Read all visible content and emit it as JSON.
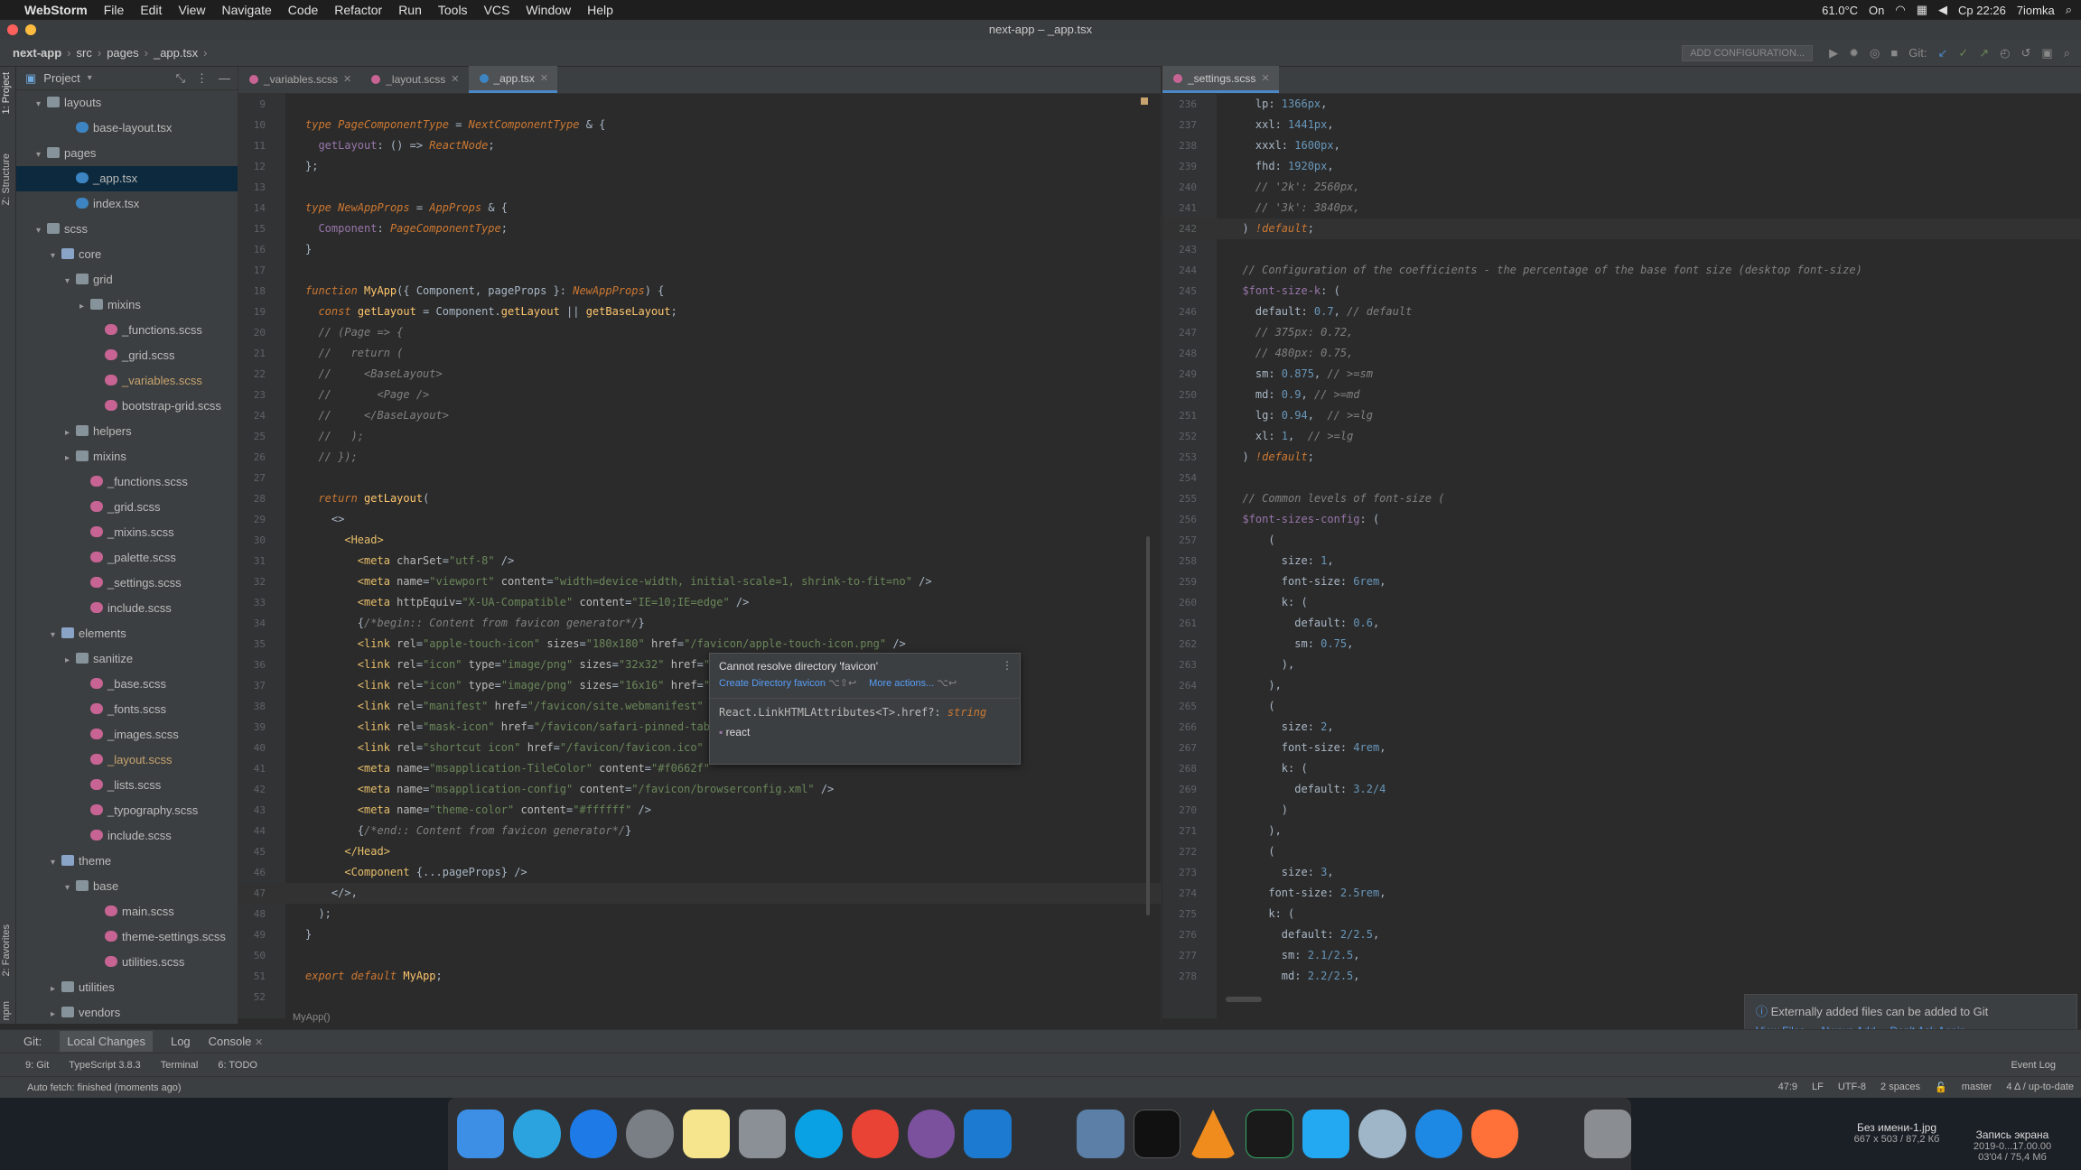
{
  "menubar": {
    "apple": "",
    "app": "WebStorm",
    "items": [
      "File",
      "Edit",
      "View",
      "Navigate",
      "Code",
      "Refactor",
      "Run",
      "Tools",
      "VCS",
      "Window",
      "Help"
    ],
    "temp": "61.0°C",
    "on": "On",
    "time": "Ср 22:26",
    "user": "7iomka"
  },
  "window": {
    "title": "next-app – _app.tsx"
  },
  "navbar": {
    "crumbs": [
      "next-app",
      "src",
      "pages",
      "_app.tsx"
    ],
    "runconfig": "ADD CONFIGURATION...",
    "git": "Git:"
  },
  "sidebar": {
    "vtabs": [
      "1: Project",
      "Z: Structure",
      "2: Favorites",
      "npm"
    ],
    "header": "Project"
  },
  "tree": [
    {
      "label": "layouts",
      "indent": 1,
      "arr": "▾",
      "icon": "folder"
    },
    {
      "label": "base-layout.tsx",
      "indent": 3,
      "arr": "",
      "icon": "tsx"
    },
    {
      "label": "pages",
      "indent": 1,
      "arr": "▾",
      "icon": "folder"
    },
    {
      "label": "_app.tsx",
      "indent": 3,
      "arr": "",
      "icon": "tsx",
      "sel": true
    },
    {
      "label": "index.tsx",
      "indent": 3,
      "arr": "",
      "icon": "tsx"
    },
    {
      "label": "scss",
      "indent": 1,
      "arr": "▾",
      "icon": "folder"
    },
    {
      "label": "core",
      "indent": 2,
      "arr": "▾",
      "icon": "fmod"
    },
    {
      "label": "grid",
      "indent": 3,
      "arr": "▾",
      "icon": "folder"
    },
    {
      "label": "mixins",
      "indent": 4,
      "arr": "▸",
      "icon": "folder"
    },
    {
      "label": "_functions.scss",
      "indent": 5,
      "arr": "",
      "icon": "scss"
    },
    {
      "label": "_grid.scss",
      "indent": 5,
      "arr": "",
      "icon": "scss"
    },
    {
      "label": "_variables.scss",
      "indent": 5,
      "arr": "",
      "icon": "scss",
      "mod": true
    },
    {
      "label": "bootstrap-grid.scss",
      "indent": 5,
      "arr": "",
      "icon": "scss"
    },
    {
      "label": "helpers",
      "indent": 3,
      "arr": "▸",
      "icon": "folder"
    },
    {
      "label": "mixins",
      "indent": 3,
      "arr": "▸",
      "icon": "folder"
    },
    {
      "label": "_functions.scss",
      "indent": 4,
      "arr": "",
      "icon": "scss"
    },
    {
      "label": "_grid.scss",
      "indent": 4,
      "arr": "",
      "icon": "scss"
    },
    {
      "label": "_mixins.scss",
      "indent": 4,
      "arr": "",
      "icon": "scss"
    },
    {
      "label": "_palette.scss",
      "indent": 4,
      "arr": "",
      "icon": "scss"
    },
    {
      "label": "_settings.scss",
      "indent": 4,
      "arr": "",
      "icon": "scss"
    },
    {
      "label": "include.scss",
      "indent": 4,
      "arr": "",
      "icon": "scss"
    },
    {
      "label": "elements",
      "indent": 2,
      "arr": "▾",
      "icon": "fmod"
    },
    {
      "label": "sanitize",
      "indent": 3,
      "arr": "▸",
      "icon": "folder"
    },
    {
      "label": "_base.scss",
      "indent": 4,
      "arr": "",
      "icon": "scss"
    },
    {
      "label": "_fonts.scss",
      "indent": 4,
      "arr": "",
      "icon": "scss"
    },
    {
      "label": "_images.scss",
      "indent": 4,
      "arr": "",
      "icon": "scss"
    },
    {
      "label": "_layout.scss",
      "indent": 4,
      "arr": "",
      "icon": "scss",
      "mod": true
    },
    {
      "label": "_lists.scss",
      "indent": 4,
      "arr": "",
      "icon": "scss"
    },
    {
      "label": "_typography.scss",
      "indent": 4,
      "arr": "",
      "icon": "scss"
    },
    {
      "label": "include.scss",
      "indent": 4,
      "arr": "",
      "icon": "scss"
    },
    {
      "label": "theme",
      "indent": 2,
      "arr": "▾",
      "icon": "fmod"
    },
    {
      "label": "base",
      "indent": 3,
      "arr": "▾",
      "icon": "folder"
    },
    {
      "label": "main.scss",
      "indent": 5,
      "arr": "",
      "icon": "scss"
    },
    {
      "label": "theme-settings.scss",
      "indent": 5,
      "arr": "",
      "icon": "scss"
    },
    {
      "label": "utilities.scss",
      "indent": 5,
      "arr": "",
      "icon": "scss"
    },
    {
      "label": "utilities",
      "indent": 2,
      "arr": "▸",
      "icon": "folder"
    },
    {
      "label": "vendors",
      "indent": 2,
      "arr": "▸",
      "icon": "folder"
    }
  ],
  "editor": {
    "tabs": [
      {
        "label": "_variables.scss",
        "icon": "scss"
      },
      {
        "label": "_layout.scss",
        "icon": "scss"
      },
      {
        "label": "_app.tsx",
        "icon": "tsx",
        "active": true
      }
    ],
    "breadcrumb": "MyApp()",
    "lines": [
      {
        "n": "9",
        "h": ""
      },
      {
        "n": "10",
        "h": "<span class='kw'>type</span> <span class='ty'>PageComponentType</span> = <span class='ty'>NextComponentType</span> & {"
      },
      {
        "n": "11",
        "h": "  <span class='var'>getLayout</span>: () => <span class='ty'>ReactNode</span>;"
      },
      {
        "n": "12",
        "h": "};"
      },
      {
        "n": "13",
        "h": ""
      },
      {
        "n": "14",
        "h": "<span class='kw'>type</span> <span class='ty'>NewAppProps</span> = <span class='ty'>AppProps</span> & {"
      },
      {
        "n": "15",
        "h": "  <span class='var'>Component</span>: <span class='ty'>PageComponentType</span>;"
      },
      {
        "n": "16",
        "h": "}"
      },
      {
        "n": "17",
        "h": ""
      },
      {
        "n": "18",
        "h": "<span class='kw'>function</span> <span class='fn'>MyApp</span>({ Component, pageProps }: <span class='ty'>NewAppProps</span>) {"
      },
      {
        "n": "19",
        "h": "  <span class='kw'>const</span> <span class='fn'>getLayout</span> = Component.<span class='fn'>getLayout</span> || <span class='fn'>getBaseLayout</span>;"
      },
      {
        "n": "20",
        "h": "  <span class='cm'>// (Page => {</span>"
      },
      {
        "n": "21",
        "h": "  <span class='cm'>//   return (</span>"
      },
      {
        "n": "22",
        "h": "  <span class='cm'>//     &lt;BaseLayout&gt;</span>"
      },
      {
        "n": "23",
        "h": "  <span class='cm'>//       &lt;Page /&gt;</span>"
      },
      {
        "n": "24",
        "h": "  <span class='cm'>//     &lt;/BaseLayout&gt;</span>"
      },
      {
        "n": "25",
        "h": "  <span class='cm'>//   );</span>"
      },
      {
        "n": "26",
        "h": "  <span class='cm'>// });</span>"
      },
      {
        "n": "27",
        "h": ""
      },
      {
        "n": "28",
        "h": "  <span class='kw'>return</span> <span class='fn'>getLayout</span>("
      },
      {
        "n": "29",
        "h": "    &lt;&gt;"
      },
      {
        "n": "30",
        "h": "      <span class='tag'>&lt;Head&gt;</span>"
      },
      {
        "n": "31",
        "h": "        <span class='tag'>&lt;meta</span> <span class='attr'>charSet</span>=<span class='str'>\"utf-8\"</span> /&gt;"
      },
      {
        "n": "32",
        "h": "        <span class='tag'>&lt;meta</span> <span class='attr'>name</span>=<span class='str'>\"viewport\"</span> <span class='attr'>content</span>=<span class='str'>\"width=device-width, initial-scale=1, shrink-to-fit=no\"</span> /&gt;"
      },
      {
        "n": "33",
        "h": "        <span class='tag'>&lt;meta</span> <span class='attr'>httpEquiv</span>=<span class='str'>\"X-UA-Compatible\"</span> <span class='attr'>content</span>=<span class='str'>\"IE=10;IE=edge\"</span> /&gt;"
      },
      {
        "n": "34",
        "h": "        {<span class='cm'>/*begin:: Content from favicon generator*/</span>}"
      },
      {
        "n": "35",
        "h": "        <span class='tag'>&lt;link</span> <span class='attr'>rel</span>=<span class='str'>\"apple-touch-icon\"</span> <span class='attr'>sizes</span>=<span class='str'>\"180x180\"</span> <span class='attr'>href</span>=<span class='str'>\"/favicon/apple-touch-icon.png\"</span> /&gt;"
      },
      {
        "n": "36",
        "h": "        <span class='tag'>&lt;link</span> <span class='attr'>rel</span>=<span class='str'>\"icon\"</span> <span class='attr'>type</span>=<span class='str'>\"image/png\"</span> <span class='attr'>sizes</span>=<span class='str'>\"32x32\"</span> <span class='attr'>href</span>=<span class='str'>\"/</span>"
      },
      {
        "n": "37",
        "h": "        <span class='tag'>&lt;link</span> <span class='attr'>rel</span>=<span class='str'>\"icon\"</span> <span class='attr'>type</span>=<span class='str'>\"image/png\"</span> <span class='attr'>sizes</span>=<span class='str'>\"16x16\"</span> <span class='attr'>href</span>=<span class='str'>\"/</span>"
      },
      {
        "n": "38",
        "h": "        <span class='tag'>&lt;link</span> <span class='attr'>rel</span>=<span class='str'>\"manifest\"</span> <span class='attr'>href</span>=<span class='str'>\"/favicon/site.webmanifest\"</span> /"
      },
      {
        "n": "39",
        "h": "        <span class='tag'>&lt;link</span> <span class='attr'>rel</span>=<span class='str'>\"mask-icon\"</span> <span class='attr'>href</span>=<span class='str'>\"/favicon/safari-pinned-tab.</span>"
      },
      {
        "n": "40",
        "h": "        <span class='tag'>&lt;link</span> <span class='attr'>rel</span>=<span class='str'>\"shortcut icon\"</span> <span class='attr'>href</span>=<span class='str'>\"/favicon/favicon.ico\"</span> /"
      },
      {
        "n": "41",
        "h": "        <span class='tag'>&lt;meta</span> <span class='attr'>name</span>=<span class='str'>\"msapplication-TileColor\"</span> <span class='attr'>content</span>=<span class='str'>\"#f0662f\"</span>"
      },
      {
        "n": "42",
        "h": "        <span class='tag'>&lt;meta</span> <span class='attr'>name</span>=<span class='str'>\"msapplication-config\"</span> <span class='attr'>content</span>=<span class='str'>\"/favicon/browserconfig.xml\"</span> /&gt;"
      },
      {
        "n": "43",
        "h": "        <span class='tag'>&lt;meta</span> <span class='attr'>name</span>=<span class='str'>\"theme-color\"</span> <span class='attr'>content</span>=<span class='str'>\"#ffffff\"</span> /&gt;"
      },
      {
        "n": "44",
        "h": "        {<span class='cm'>/*end:: Content from favicon generator*/</span>}"
      },
      {
        "n": "45",
        "h": "      <span class='tag'>&lt;/Head&gt;</span>"
      },
      {
        "n": "46",
        "h": "      <span class='tag'>&lt;Component</span> {...pageProps} /&gt;"
      },
      {
        "n": "47",
        "h": "    &lt;/&gt;,",
        "cur": true
      },
      {
        "n": "48",
        "h": "  );"
      },
      {
        "n": "49",
        "h": "}"
      },
      {
        "n": "50",
        "h": ""
      },
      {
        "n": "51",
        "h": "<span class='kw'>export default</span> <span class='fn'>MyApp</span>;"
      },
      {
        "n": "52",
        "h": ""
      }
    ]
  },
  "popup": {
    "title": "Cannot resolve directory 'favicon'",
    "action1": "Create Directory favicon",
    "key1": "⌥⇧↩",
    "action2": "More actions...",
    "key2": "⌥↩",
    "sig": "React.LinkHTMLAttributes<T>.href?:",
    "sigtype": "string",
    "pkg": "react"
  },
  "editor2": {
    "tab": "_settings.scss",
    "lines": [
      {
        "n": "236",
        "h": "    lp: <span class='num2'>1366px</span>,"
      },
      {
        "n": "237",
        "h": "    xxl: <span class='num2'>1441px</span>,"
      },
      {
        "n": "238",
        "h": "    xxxl: <span class='num2'>1600px</span>,"
      },
      {
        "n": "239",
        "h": "    fhd: <span class='num2'>1920px</span>,"
      },
      {
        "n": "240",
        "h": "    <span class='cm'>// '2k': 2560px,</span>"
      },
      {
        "n": "241",
        "h": "    <span class='cm'>// '3k': 3840px,</span>"
      },
      {
        "n": "242",
        "h": "  ) <span class='kw'>!default</span>;",
        "cur": true
      },
      {
        "n": "243",
        "h": ""
      },
      {
        "n": "244",
        "h": "  <span class='cm'>// Configuration of the coefficients - the percentage of the base font size (desktop font-size)</span>"
      },
      {
        "n": "245",
        "h": "  <span class='var'>$font-size-k</span>: ("
      },
      {
        "n": "246",
        "h": "    default: <span class='num2'>0.7</span>, <span class='cm'>// default</span>"
      },
      {
        "n": "247",
        "h": "    <span class='cm'>// 375px: 0.72,</span>"
      },
      {
        "n": "248",
        "h": "    <span class='cm'>// 480px: 0.75,</span>"
      },
      {
        "n": "249",
        "h": "    sm: <span class='num2'>0.875</span>, <span class='cm'>// >=sm</span>"
      },
      {
        "n": "250",
        "h": "    md: <span class='num2'>0.9</span>, <span class='cm'>// >=md</span>"
      },
      {
        "n": "251",
        "h": "    lg: <span class='num2'>0.94</span>,  <span class='cm'>// >=lg</span>"
      },
      {
        "n": "252",
        "h": "    xl: <span class='num2'>1</span>,  <span class='cm'>// >=lg</span>"
      },
      {
        "n": "253",
        "h": "  ) <span class='kw'>!default</span>;"
      },
      {
        "n": "254",
        "h": ""
      },
      {
        "n": "255",
        "h": "  <span class='cm'>// Common levels of font-size (</span>"
      },
      {
        "n": "256",
        "h": "  <span class='var'>$font-sizes-config</span>: ("
      },
      {
        "n": "257",
        "h": "      ("
      },
      {
        "n": "258",
        "h": "        size: <span class='num2'>1</span>,"
      },
      {
        "n": "259",
        "h": "        font-size: <span class='num2'>6rem</span>,"
      },
      {
        "n": "260",
        "h": "        k: ("
      },
      {
        "n": "261",
        "h": "          default: <span class='num2'>0.6</span>,"
      },
      {
        "n": "262",
        "h": "          sm: <span class='num2'>0.75</span>,"
      },
      {
        "n": "263",
        "h": "        ),"
      },
      {
        "n": "264",
        "h": "      ),"
      },
      {
        "n": "265",
        "h": "      ("
      },
      {
        "n": "266",
        "h": "        size: <span class='num2'>2</span>,"
      },
      {
        "n": "267",
        "h": "        font-size: <span class='num2'>4rem</span>,"
      },
      {
        "n": "268",
        "h": "        k: ("
      },
      {
        "n": "269",
        "h": "          default: <span class='num2'>3.2/4</span>"
      },
      {
        "n": "270",
        "h": "        )"
      },
      {
        "n": "271",
        "h": "      ),"
      },
      {
        "n": "272",
        "h": "      ("
      },
      {
        "n": "273",
        "h": "        size: <span class='num2'>3</span>,"
      },
      {
        "n": "274",
        "h": "      font-size: <span class='num2'>2.5rem</span>,"
      },
      {
        "n": "275",
        "h": "      k: ("
      },
      {
        "n": "276",
        "h": "        default: <span class='num2'>2/2.5</span>,"
      },
      {
        "n": "277",
        "h": "        sm: <span class='num2'>2.1/2.5</span>,"
      },
      {
        "n": "278",
        "h": "        md: <span class='num2'>2.2/2.5</span>,"
      }
    ]
  },
  "notif": {
    "title": "Externally added files can be added to Git",
    "l1": "View Files",
    "l2": "Always Add",
    "l3": "Don't Ask Again"
  },
  "bottom": {
    "git": "Git:",
    "tabs": [
      "Local Changes",
      "Log",
      "Console"
    ]
  },
  "toolwin": {
    "items": [
      "9: Git",
      "TypeScript 3.8.3",
      "Terminal",
      "6: TODO"
    ],
    "eventlog": "Event Log"
  },
  "status": {
    "msg": "Auto fetch: finished (moments ago)",
    "pos": "47:9",
    "lf": "LF",
    "enc": "UTF-8",
    "indent": "2 spaces",
    "branch": "master",
    "vcs": "4 Δ / up-to-date"
  },
  "desktop": {
    "file1": "Без имени-1.jpg",
    "file1b": "667 x 503 / 87,2 Кб",
    "file2": "Запись экрана",
    "file2b": "2019-0...17.00.00",
    "file2c": "03'04 / 75,4 Мб"
  }
}
